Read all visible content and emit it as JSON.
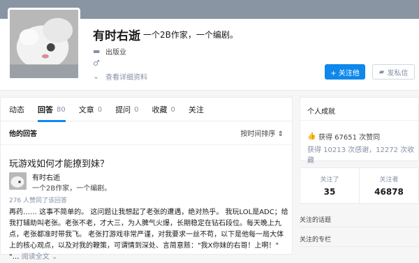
{
  "profile": {
    "name": "有时右逝",
    "headline": "一个2B作家，一个编剧。",
    "industry": "出版业",
    "gender_symbol": "♂",
    "more_link": "查看详细资料",
    "follow_button": "+ 关注他",
    "message_button": "发私信"
  },
  "tabs": [
    {
      "label": "动态",
      "count": ""
    },
    {
      "label": "回答",
      "count": "80"
    },
    {
      "label": "文章",
      "count": "0"
    },
    {
      "label": "提问",
      "count": "0"
    },
    {
      "label": "收藏",
      "count": "0"
    },
    {
      "label": "关注",
      "count": ""
    }
  ],
  "answers": {
    "section_title": "他的回答",
    "sort_label": "按时间排序 ⇕",
    "item": {
      "question": "玩游戏如何才能撩到妹？",
      "author": "有时右逝",
      "author_bio": "一个2B作家，一个编剧。",
      "votes": "276 人赞同了该回答",
      "excerpt": "再药…… 这事不简单的。 这问题让我想起了老张的遭遇，绝对热乎。 我玩LOL是ADC；给我打辅助叫老张。老张不老，才大三，为人脾气火爆，长期稳定在钻石段位。每天晚上九点，老张都准时带我飞。 老张打游戏非常严谨，对我要求一丝不苟，以下是他每一局大体上的核心观点，以及对我的鞭策，可谓情到深处、言简意赅：\"我X你妹的右哥！上啊！\" \"…",
      "read_more": "阅读全文 ⌄"
    }
  },
  "sidebar": {
    "achievements_title": "个人成就",
    "likes": "获得 67651 次赞同",
    "thanks": "获得 10213 次感谢，12272 次收藏",
    "following_label": "关注了",
    "following_count": "35",
    "followers_label": "关注者",
    "followers_count": "46878",
    "topics_link": "关注的话题",
    "columns_link": "关注的专栏"
  }
}
